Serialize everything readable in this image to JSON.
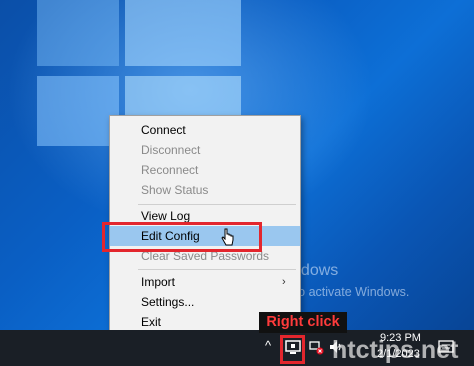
{
  "menu": {
    "items": [
      {
        "label": "Connect",
        "disabled": false
      },
      {
        "label": "Disconnect",
        "disabled": true
      },
      {
        "label": "Reconnect",
        "disabled": true
      },
      {
        "label": "Show Status",
        "disabled": true
      },
      {
        "label": "View Log",
        "disabled": false
      },
      {
        "label": "Edit Config",
        "disabled": false,
        "highlighted": true
      },
      {
        "label": "Clear Saved Passwords",
        "disabled": true
      },
      {
        "label": "Import",
        "disabled": false,
        "has_submenu": true
      },
      {
        "label": "Settings...",
        "disabled": false
      },
      {
        "label": "Exit",
        "disabled": false
      }
    ],
    "submenu_arrow": "›"
  },
  "watermark": {
    "title": "Activate Windows",
    "subtitle": "Go to Settings to activate Windows."
  },
  "callout": {
    "label": "Right click"
  },
  "taskbar": {
    "chevron": "^",
    "clock_time": "9:23 PM",
    "clock_date": "2/1/2023",
    "icons": [
      "openvpn-tray-icon",
      "network-disconnected-icon",
      "volume-icon",
      "language-icon",
      "notifications-icon"
    ]
  },
  "site_watermark": "htctips.net",
  "colors": {
    "highlight": "#9ac7ef",
    "red_annotation": "#e3262d",
    "taskbar": "#1a1f26"
  }
}
